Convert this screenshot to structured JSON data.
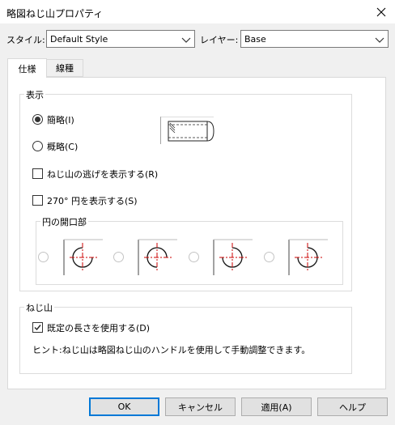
{
  "window": {
    "title": "略図ねじ山プロパティ",
    "close_icon": "close-icon"
  },
  "style_row": {
    "style_label": "スタイル:",
    "style_value": "Default Style",
    "layer_label": "レイヤー:",
    "layer_value": "Base"
  },
  "tabs": [
    {
      "label": "仕様",
      "active": true
    },
    {
      "label": "線種",
      "active": false
    }
  ],
  "display_group": {
    "title": "表示",
    "radio_simplified": "簡略(I)",
    "radio_schematic": "概略(C)",
    "radio_selected": "simplified",
    "check_runout": "ねじ山の逃げを表示する(R)",
    "check_runout_checked": false,
    "check_270": "270° 円を表示する(S)",
    "check_270_checked": false,
    "opening_group_title": "円の開口部",
    "opening_options": [
      "top-right",
      "bottom-right",
      "top-left",
      "bottom-left"
    ]
  },
  "thread_group": {
    "title": "ねじ山",
    "check_default_length": "既定の長さを使用する(D)",
    "check_default_length_checked": true,
    "hint": "ヒント:ねじ山は略図ねじ山のハンドルを使用して手動調整できます。"
  },
  "buttons": {
    "ok": "OK",
    "cancel": "キャンセル",
    "apply": "適用(A)",
    "help": "ヘルプ"
  },
  "colors": {
    "accent": "#0078d7",
    "centerline": "#cc0000",
    "dialog_bg": "#f0f0f0"
  }
}
